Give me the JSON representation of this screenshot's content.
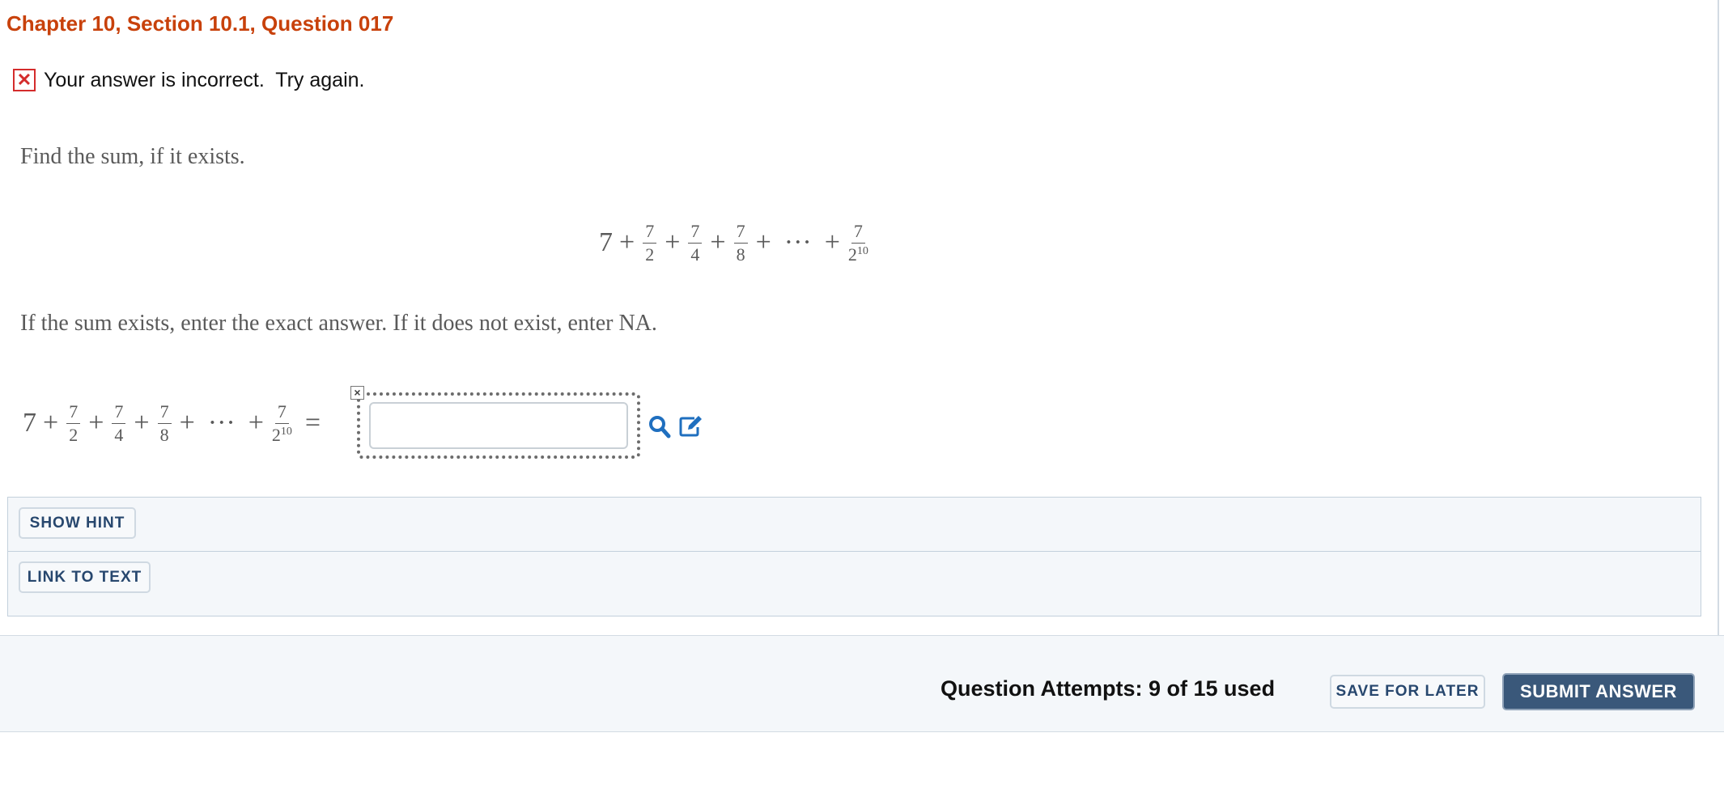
{
  "header": {
    "title": "Chapter 10, Section 10.1, Question 017"
  },
  "feedback": {
    "icon": "x-mark-icon",
    "status": "incorrect",
    "message": "Your answer is incorrect.  Try again."
  },
  "question": {
    "prompt": "Find the sum, if it exists.",
    "series": {
      "lead_term": "7",
      "plus": "+",
      "ellipsis": "···",
      "equals": "=",
      "terms": [
        {
          "num": "7",
          "den": "2",
          "exp": ""
        },
        {
          "num": "7",
          "den": "4",
          "exp": ""
        },
        {
          "num": "7",
          "den": "8",
          "exp": ""
        }
      ],
      "last_term": {
        "num": "7",
        "den": "2",
        "exp": "10"
      }
    },
    "instruction": "If the sum exists, enter the exact answer. If it does not exist, enter NA.",
    "answer": {
      "value": "",
      "placeholder": ""
    },
    "close_glyph": "×"
  },
  "tools": {
    "search_icon": "magnifier-icon",
    "edit_icon": "edit-icon"
  },
  "hint_panel": {
    "show_hint_label": "SHOW HINT",
    "link_to_text_label": "LINK TO TEXT"
  },
  "footer": {
    "attempts": "Question Attempts: 9 of 15 used",
    "save_later_label": "SAVE FOR LATER",
    "submit_label": "SUBMIT ANSWER"
  },
  "colors": {
    "title": "#c8410b",
    "error": "#d42c2c",
    "icon_blue": "#1f6fbf",
    "submit_bg": "#3a587a",
    "button_text": "#27476e"
  }
}
